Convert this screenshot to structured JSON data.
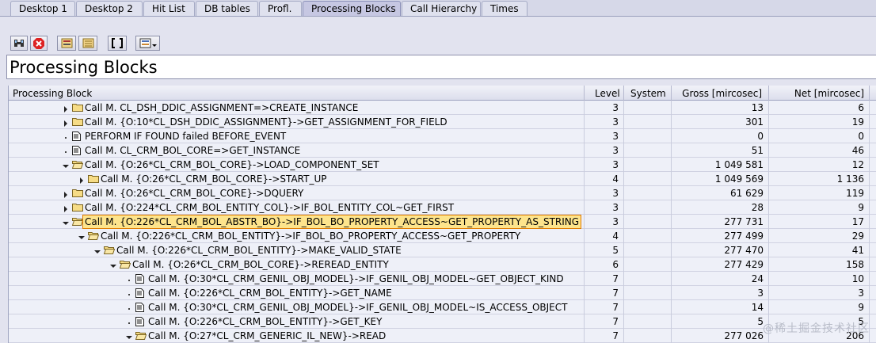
{
  "tabs": [
    "Desktop 1",
    "Desktop 2",
    "Hit List",
    "DB tables",
    "Profl.",
    "Processing Blocks",
    "Call Hierarchy",
    "Times"
  ],
  "title": "Processing Blocks",
  "columns": {
    "block": "Processing Block",
    "level": "Level",
    "system": "System",
    "gross": "Gross [mircosec]",
    "net": "Net [mircosec]"
  },
  "rows": [
    {
      "text": "Call M. CL_DSH_DDIC_ASSIGNMENT=>CREATE_INSTANCE",
      "level": "3",
      "system": "",
      "gross": "13",
      "net": "6",
      "arrow": "right",
      "icon": "folder",
      "indent": 0
    },
    {
      "text": "Call M. {O:10*CL_DSH_DDIC_ASSIGNMENT}->GET_ASSIGNMENT_FOR_FIELD",
      "level": "3",
      "system": "",
      "gross": "301",
      "net": "19",
      "arrow": "right",
      "icon": "folder",
      "indent": 0
    },
    {
      "text": "PERFORM IF FOUND failed BEFORE_EVENT",
      "level": "3",
      "system": "",
      "gross": "0",
      "net": "0",
      "arrow": "dot",
      "icon": "doc",
      "indent": 0
    },
    {
      "text": "Call M. CL_CRM_BOL_CORE=>GET_INSTANCE",
      "level": "3",
      "system": "",
      "gross": "51",
      "net": "46",
      "arrow": "dot",
      "icon": "doc",
      "indent": 0
    },
    {
      "text": "Call M. {O:26*CL_CRM_BOL_CORE}->LOAD_COMPONENT_SET",
      "level": "3",
      "system": "",
      "gross": "1 049 581",
      "net": "12",
      "arrow": "down",
      "icon": "folder-open",
      "indent": 0
    },
    {
      "text": "Call M. {O:26*CL_CRM_BOL_CORE}->START_UP",
      "level": "4",
      "system": "",
      "gross": "1 049 569",
      "net": "1 136",
      "arrow": "right",
      "icon": "folder",
      "indent": 1
    },
    {
      "text": "Call M. {O:26*CL_CRM_BOL_CORE}->DQUERY",
      "level": "3",
      "system": "",
      "gross": "61 629",
      "net": "119",
      "arrow": "right",
      "icon": "folder",
      "indent": 0
    },
    {
      "text": "Call M. {O:224*CL_CRM_BOL_ENTITY_COL}->IF_BOL_ENTITY_COL~GET_FIRST",
      "level": "3",
      "system": "",
      "gross": "28",
      "net": "9",
      "arrow": "right",
      "icon": "folder",
      "indent": 0
    },
    {
      "text": "Call M. {O:226*CL_CRM_BOL_ABSTR_BO}->IF_BOL_BO_PROPERTY_ACCESS~GET_PROPERTY_AS_STRING",
      "level": "3",
      "system": "",
      "gross": "277 731",
      "net": "17",
      "arrow": "down",
      "icon": "folder-open",
      "indent": 0,
      "highlight": true
    },
    {
      "text": "Call M. {O:226*CL_CRM_BOL_ENTITY}->IF_BOL_BO_PROPERTY_ACCESS~GET_PROPERTY",
      "level": "4",
      "system": "",
      "gross": "277 499",
      "net": "29",
      "arrow": "down",
      "icon": "folder-open",
      "indent": 1
    },
    {
      "text": "Call M. {O:226*CL_CRM_BOL_ENTITY}->MAKE_VALID_STATE",
      "level": "5",
      "system": "",
      "gross": "277 470",
      "net": "41",
      "arrow": "down",
      "icon": "folder-open",
      "indent": 2
    },
    {
      "text": "Call M. {O:26*CL_CRM_BOL_CORE}->REREAD_ENTITY",
      "level": "6",
      "system": "",
      "gross": "277 429",
      "net": "158",
      "arrow": "down",
      "icon": "folder-open",
      "indent": 3
    },
    {
      "text": "Call M. {O:30*CL_CRM_GENIL_OBJ_MODEL}->IF_GENIL_OBJ_MODEL~GET_OBJECT_KIND",
      "level": "7",
      "system": "",
      "gross": "24",
      "net": "10",
      "arrow": "dot",
      "icon": "doc",
      "indent": 4
    },
    {
      "text": "Call M. {O:226*CL_CRM_BOL_ENTITY}->GET_NAME",
      "level": "7",
      "system": "",
      "gross": "3",
      "net": "3",
      "arrow": "dot",
      "icon": "doc",
      "indent": 4
    },
    {
      "text": "Call M. {O:30*CL_CRM_GENIL_OBJ_MODEL}->IF_GENIL_OBJ_MODEL~IS_ACCESS_OBJECT",
      "level": "7",
      "system": "",
      "gross": "14",
      "net": "9",
      "arrow": "dot",
      "icon": "doc",
      "indent": 4
    },
    {
      "text": "Call M. {O:226*CL_CRM_BOL_ENTITY}->GET_KEY",
      "level": "7",
      "system": "",
      "gross": "5",
      "net": "5",
      "arrow": "dot",
      "icon": "doc",
      "indent": 4
    },
    {
      "text": "Call M. {O:27*CL_CRM_GENERIC_IL_NEW}->READ",
      "level": "7",
      "system": "",
      "gross": "277 026",
      "net": "206",
      "arrow": "down",
      "icon": "folder-open",
      "indent": 4
    }
  ],
  "toolbar_icons": [
    "display-icon",
    "stop-icon",
    "expand-icon",
    "collapse-icon",
    "brackets-icon",
    "layout-icon"
  ],
  "watermark": "@稀土掘金技术社区"
}
